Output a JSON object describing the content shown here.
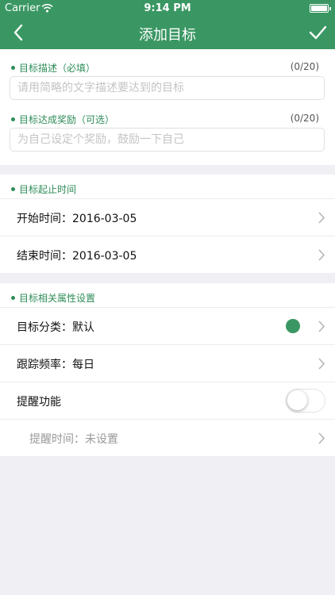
{
  "status": {
    "carrier": "Carrier",
    "time": "9:14 PM"
  },
  "nav": {
    "title": "添加目标"
  },
  "description": {
    "label": "目标描述（必填）",
    "counter": "(0/20)",
    "placeholder": "请用简略的文字描述要达到的目标",
    "value": ""
  },
  "reward": {
    "label": "目标达成奖励（可选）",
    "counter": "(0/20)",
    "placeholder": "为自己设定个奖励，鼓励一下自己",
    "value": ""
  },
  "period": {
    "label": "目标起止时间",
    "start": "开始时间：2016-03-05",
    "end": "结束时间：2016-03-05"
  },
  "attributes": {
    "label": "目标相关属性设置",
    "category": "目标分类：默认",
    "category_color": "#3a9763",
    "frequency": "跟踪频率：每日",
    "reminder": "提醒功能",
    "reminder_on": false,
    "reminder_time": "提醒时间：未设置"
  },
  "icons": {
    "back": "chevron-left-icon",
    "confirm": "checkmark-icon",
    "row": "chevron-right-icon"
  }
}
